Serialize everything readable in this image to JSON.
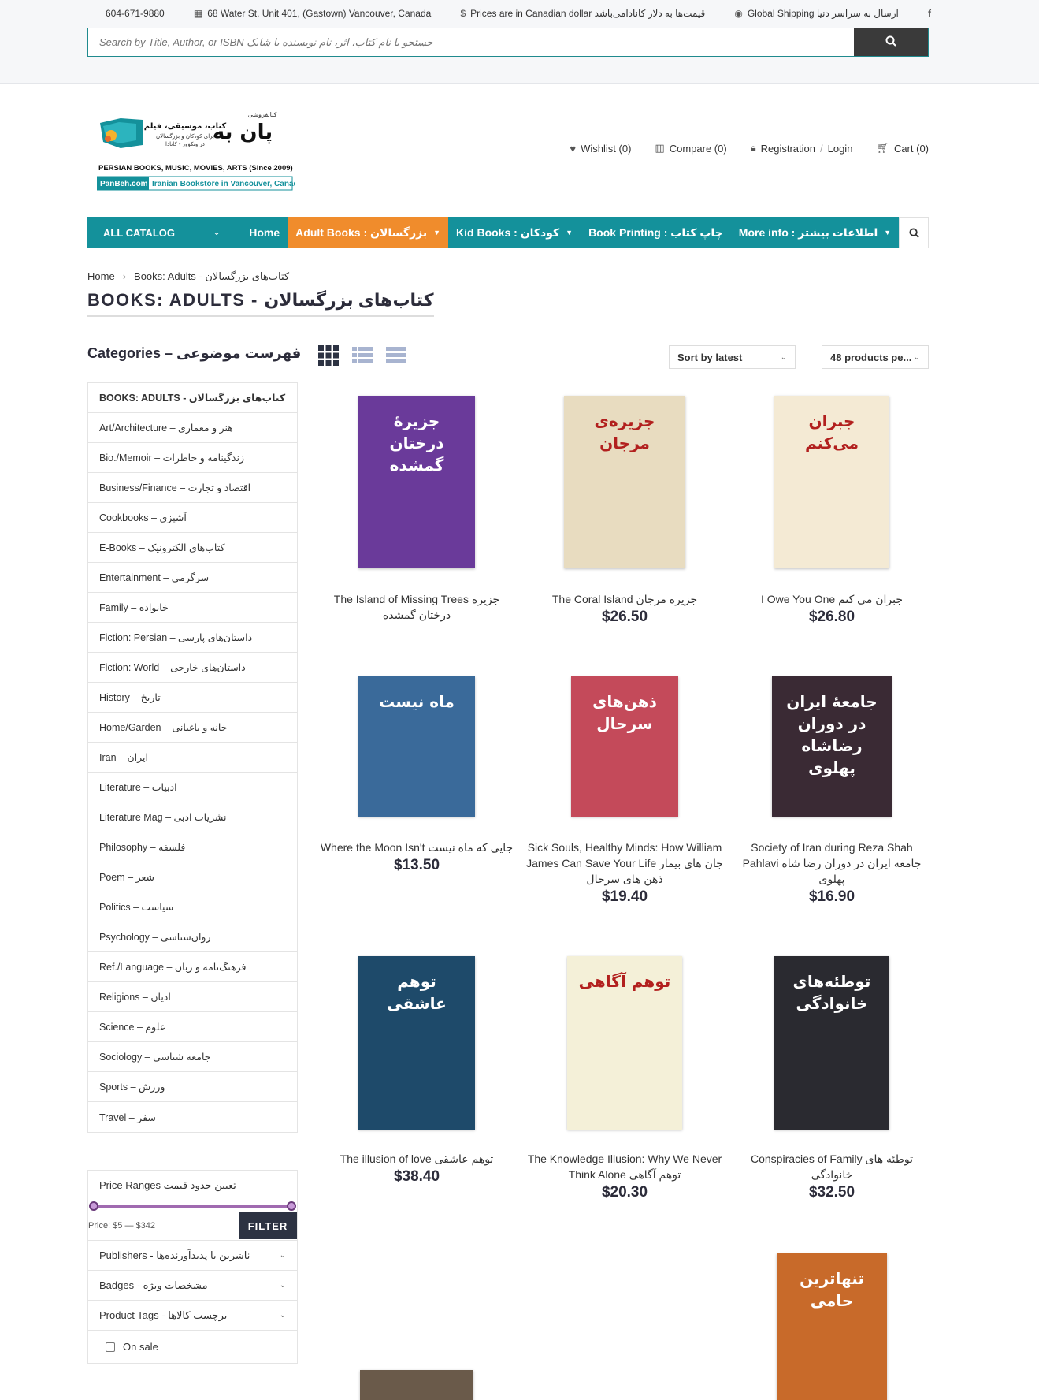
{
  "topbar": {
    "phone": "604-671-9880",
    "address": "68 Water St. Unit 401, (Gastown) Vancouver, Canada",
    "prices": "Prices are in Canadian dollar قیمت‌ها به دلار کانادامی‌باشد",
    "shipping": "Global Shipping ارسال به سراسر دنیا",
    "search_placeholder": "Search by Title, Author, or ISBN جستجو با نام کتاب، اثر، نام نویسنده یا شابک"
  },
  "logo": {
    "brand_fa": "پان به",
    "store_fa": "کتابفروشی",
    "tag_fa": "کتاب، موسیقی، فیلم",
    "sub_fa": "برای کودکان و بزرگسالان",
    "loc_fa": "در ونکوور - کانادا",
    "line1": "PERSIAN BOOKS, MUSIC, MOVIES, ARTS (Since 2009)",
    "line2_a": "PanBeh.com",
    "line2_b": "Iranian Bookstore in Vancouver, Canada"
  },
  "header_links": {
    "wishlist": "Wishlist (0)",
    "compare": "Compare (0)",
    "registration": "Registration",
    "login": "Login",
    "cart": "Cart (0)"
  },
  "nav": {
    "catalog": "ALL CATALOG",
    "items": [
      "Home",
      "Adult Books : بزرگسالان",
      "Kid Books : کودکان",
      "Book Printing : چاپ کتاب",
      "More info : اطلاعات بیشتر"
    ]
  },
  "breadcrumb": {
    "home": "Home",
    "current": "Books: Adults - کتاب‌های بزرگسالان"
  },
  "page_title": "BOOKS: ADULTS - کتاب‌های بزرگسالان",
  "sidebar": {
    "heading": "Categories – فهرست موضوعی",
    "categories": [
      "BOOKS: ADULTS - کتاب‌های بزرگسالان",
      "Art/Architecture – هنر و معماری",
      "Bio./Memoir – زندگینامه و خاطرات",
      "Business/Finance – اقتصاد و تجارت",
      "Cookbooks – آشپزی",
      "E-Books – کتاب‌های الکترونیک",
      "Entertainment – سرگرمی",
      "Family – خانواده",
      "Fiction: Persian – داستان‌های پارسی",
      "Fiction: World – داستان‌های خارجی",
      "History – تاریخ",
      "Home/Garden – خانه و باغبانی",
      "Iran – ایران",
      "Literature – ادبیات",
      "Literature Mag – نشریات ادبی",
      "Philosophy – فلسفه",
      "Poem – شعر",
      "Politics – سیاست",
      "Psychology – روان‌شناسی",
      "Ref./Language – فرهنگ‌نامه و زبان",
      "Religions – ادیان",
      "Science – علوم",
      "Sociology – جامعه شناسی",
      "Sports – ورزش",
      "Travel – سفر"
    ],
    "price_heading": "Price Ranges تعیین حدود قیمت",
    "price_label": "Price: $5 — $342",
    "price_range": {
      "min": 5,
      "max": 342
    },
    "filter_button": "FILTER",
    "filters": [
      "Publishers - ناشرین یا پدیدآورنده‌ها",
      "Badges - مشخصات ویژه",
      "Product Tags - برچسب کالاها"
    ],
    "on_sale": "On sale"
  },
  "toolbar": {
    "sort": "Sort by latest",
    "per_page": "48 products pe..."
  },
  "products": [
    {
      "title": "The Island of Missing Trees جزیره درختان گمشده",
      "price": "",
      "cover_text": "جزیرهٔ درختان گمشده",
      "bg": "#6a3a9a"
    },
    {
      "title": "The Coral Island جزیره مرجان",
      "price": "$26.50",
      "cover_text": "جزیره‌ی مرجان",
      "bg": "#e8dcc0"
    },
    {
      "title": "I Owe You One جبران می کنم",
      "price": "$26.80",
      "cover_text": "جبران می‌کنم",
      "bg": "#f4ead4"
    },
    {
      "title": "Where the Moon Isn't جایی که ماه نیست",
      "price": "$13.50",
      "cover_text": "ماه نیست",
      "bg": "#3a6a9a"
    },
    {
      "title": "Sick Souls, Healthy Minds: How William James Can Save Your Life جان های بیمار ذهن های سرحال",
      "price": "$19.40",
      "cover_text": "ذهن‌های سرحال",
      "bg": "#c44a5a"
    },
    {
      "title": "Society of Iran during Reza Shah Pahlavi جامعه ایران در دوران رضا شاه پهلوی",
      "price": "$16.90",
      "cover_text": "جامعهٔ ایران در دوران رضاشاه پهلوی",
      "bg": "#3a2a34"
    },
    {
      "title": "The illusion of love توهم عاشقی",
      "price": "$38.40",
      "cover_text": "توهم عاشقی",
      "bg": "#1e4a6a"
    },
    {
      "title": "The Knowledge Illusion: Why We Never Think Alone توهم آگاهی",
      "price": "$20.30",
      "cover_text": "توهم آگاهی",
      "bg": "#f4f0d8"
    },
    {
      "title": "Conspiracies of Family توطئه های خانوادگی",
      "price": "$32.50",
      "cover_text": "توطئه‌های خانوادگی",
      "bg": "#2a2a30"
    },
    {
      "title": "",
      "price": "",
      "cover_text": "",
      "bg": "#6a5a4a"
    },
    {
      "title": "",
      "price": "",
      "cover_text": "تنهاترین حامی",
      "bg": "#c86a2a"
    }
  ],
  "colors": {
    "nav": "#14919b",
    "nav_active": "#f08c2c",
    "dark": "#2c3242"
  }
}
